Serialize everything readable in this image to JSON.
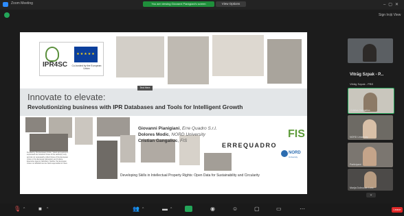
{
  "window": {
    "app_title": "Zoom Meeting",
    "share_banner": "You are viewing Giovanni Pianigiani's screen",
    "view_options_label": "View Options",
    "sign_in": "Sign In",
    "view_label": "View"
  },
  "slide": {
    "project_logo_text": "IPR4SC",
    "eu_caption": "Co-funded by the European Union",
    "tag": "Text Here",
    "title": "Innovate to elevate:",
    "subtitle": "Revolutionizing business with IPR Databases and Tools for Intelligent Growth",
    "authors": [
      {
        "name": "Giovanni Pianigiani",
        "org": "Erre Quadro S.r.l."
      },
      {
        "name": "Dolores Modic",
        "org": "NORD University"
      },
      {
        "name": "Cristian Gangaliuc",
        "org": "FIS"
      }
    ],
    "erre_logo": "ERREQUADRO",
    "fis_logo": "FIS",
    "nord_logo": "NORD",
    "nord_sub": "University",
    "eu_note": "Funded by the European Union. Views and opinions expressed are however those of the author(s) only and do not necessarily reflect those of the European Union or the European Education and Culture Executive Agency (EACEA). Neither the European Union nor EACEA can be held responsible for them.",
    "footer": "Developing Skills in Intellectual Property Rights: Open Data for Sustainability and Circularity"
  },
  "participants": {
    "speaker_name": "Vitrăg Szpak - P...",
    "speaker_sub": "Vitrăg Szpak - PBS",
    "tiles": [
      {
        "name": "Cristian Gangaliuc"
      },
      {
        "name": "NORD University"
      },
      {
        "name": "Participant"
      },
      {
        "name": "Marija Dobrocvic Loric"
      }
    ]
  },
  "toolbar": {
    "leave_label": "Leave"
  }
}
